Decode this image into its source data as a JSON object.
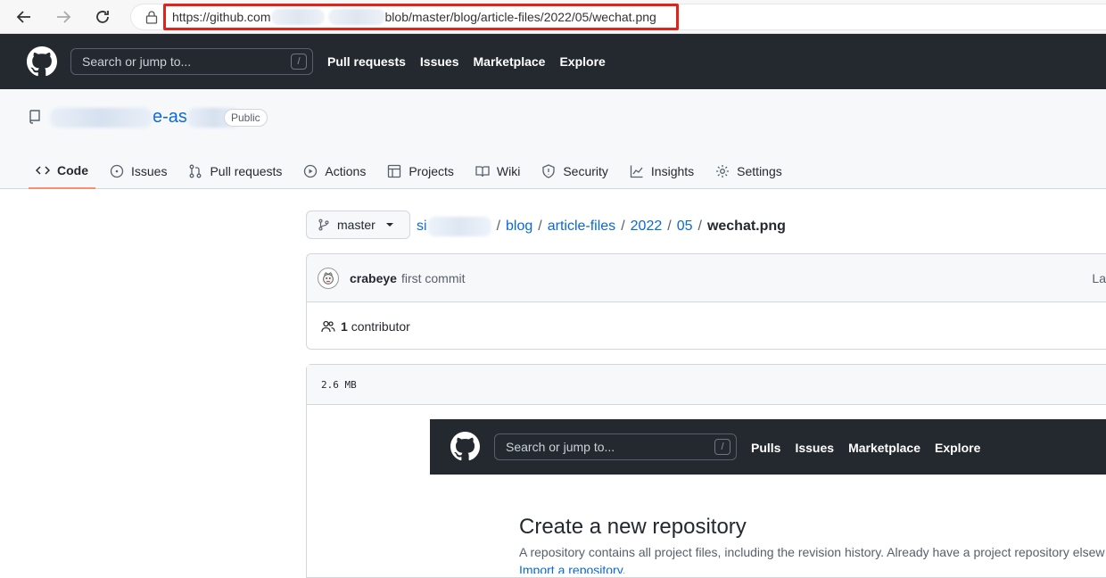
{
  "browser": {
    "url_prefix": "https://github.com",
    "url_suffix": "blob/master/blog/article-files/2022/05/wechat.png"
  },
  "github_header": {
    "search_placeholder": "Search or jump to...",
    "slash_key": "/",
    "nav": [
      "Pull requests",
      "Issues",
      "Marketplace",
      "Explore"
    ]
  },
  "repo": {
    "name_visible": "e-as",
    "visibility": "Public",
    "tabs": [
      {
        "label": "Code",
        "icon": "code-icon",
        "active": true
      },
      {
        "label": "Issues",
        "icon": "issue-icon"
      },
      {
        "label": "Pull requests",
        "icon": "pull-request-icon"
      },
      {
        "label": "Actions",
        "icon": "play-icon"
      },
      {
        "label": "Projects",
        "icon": "table-icon"
      },
      {
        "label": "Wiki",
        "icon": "book-icon"
      },
      {
        "label": "Security",
        "icon": "shield-icon"
      },
      {
        "label": "Insights",
        "icon": "graph-icon"
      },
      {
        "label": "Settings",
        "icon": "gear-icon"
      }
    ]
  },
  "file": {
    "branch": "master",
    "breadcrumb_root": "si",
    "breadcrumb": [
      "blog",
      "article-files",
      "2022",
      "05"
    ],
    "filename": "wechat.png",
    "commit_author": "crabeye",
    "commit_message": "first commit",
    "commit_right": "La",
    "contributor_count": "1",
    "contributor_label": "contributor",
    "size": "2.6 MB"
  },
  "embedded_image": {
    "search_placeholder": "Search or jump to...",
    "slash_key": "/",
    "nav": [
      "Pulls",
      "Issues",
      "Marketplace",
      "Explore"
    ],
    "title": "Create a new repository",
    "description": "A repository contains all project files, including the revision history. Already have a project repository elsew",
    "link": "Import a repository."
  },
  "colors": {
    "header_bg": "#24292f",
    "link": "#0969da",
    "annotation_red": "#e2231a",
    "active_tab_underline": "#fd8c73"
  }
}
